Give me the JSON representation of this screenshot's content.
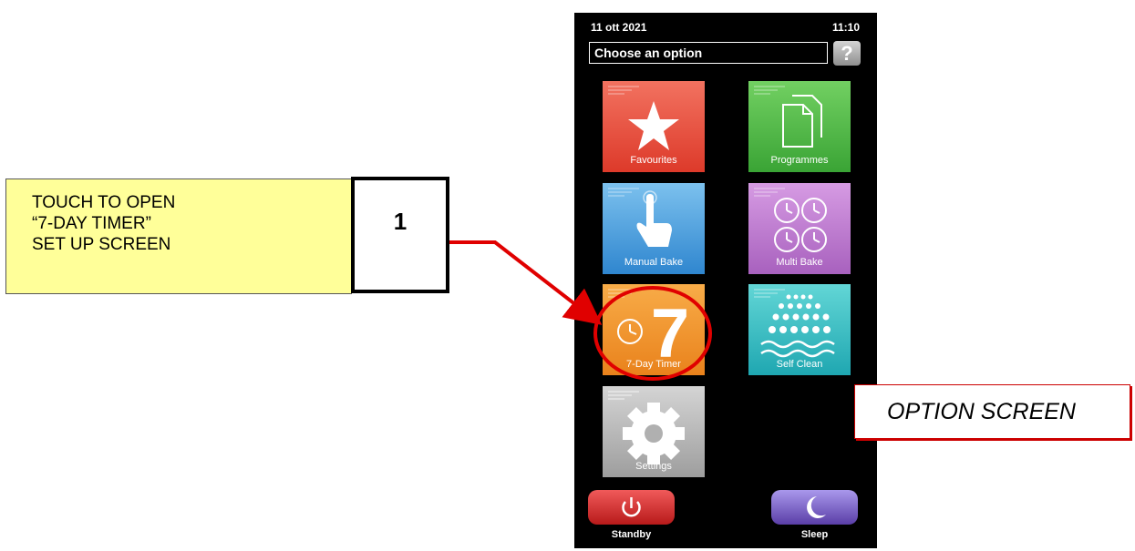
{
  "callout": {
    "lines": [
      "TOUCH TO OPEN",
      "“7-DAY TIMER”",
      "SET UP SCREEN"
    ],
    "step_number": "1"
  },
  "screen_label": "OPTION SCREEN",
  "status": {
    "date": "11 ott 2021",
    "time": "11:10"
  },
  "header": {
    "title": "Choose an option",
    "help_icon": "?"
  },
  "tiles": [
    {
      "label": "Favourites",
      "icon": "star-icon"
    },
    {
      "label": "Programmes",
      "icon": "documents-icon"
    },
    {
      "label": "Manual Bake",
      "icon": "hand-pointer-icon"
    },
    {
      "label": "Multi Bake",
      "icon": "four-clocks-icon"
    },
    {
      "label": "7-Day Timer",
      "icon": "seven-day-clock-icon",
      "digit": "7"
    },
    {
      "label": "Self Clean",
      "icon": "water-drops-icon"
    },
    {
      "label": "Settings",
      "icon": "gear-icon"
    }
  ],
  "bottom": {
    "standby": {
      "label": "Standby",
      "icon": "power-icon"
    },
    "sleep": {
      "label": "Sleep",
      "icon": "moon-icon"
    }
  },
  "colors": {
    "callout_bg": "#ffff99",
    "arrow": "#e00000",
    "favourites": "#e9503d",
    "programmes": "#52bb48",
    "manual_bake": "#4aa0e0",
    "multi_bake": "#c07fd0",
    "seven_day_timer": "#f09530",
    "self_clean": "#36c0c4",
    "settings": "#b8b8b8",
    "standby": "#d82d2d",
    "sleep": "#7a62c9"
  }
}
